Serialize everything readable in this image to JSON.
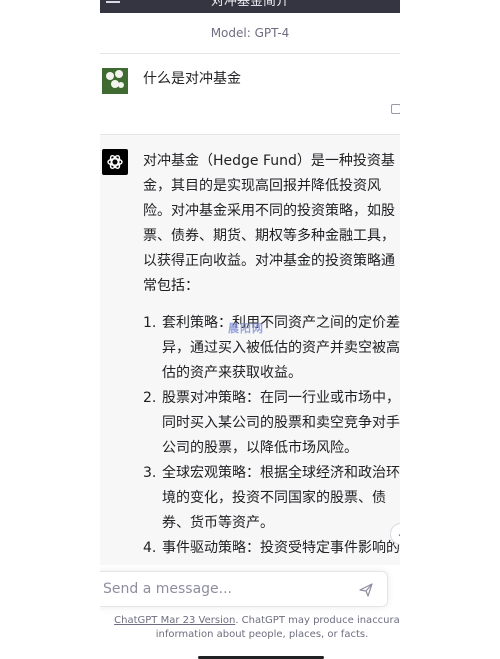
{
  "header": {
    "title": "对冲基金简介",
    "model_label": "Model: GPT-4"
  },
  "user_message": {
    "text": "什么是对冲基金"
  },
  "assistant_message": {
    "intro": "对冲基金（Hedge Fund）是一种投资基金，其目的是实现高回报并降低投资风险。对冲基金采用不同的投资策略，如股票、债券、期货、期权等多种金融工具，以获得正向收益。对冲基金的投资策略通常包括：",
    "items": [
      {
        "num": "1.",
        "text": "套利策略：利用不同资产之间的定价差异，通过买入被低估的资产并卖空被高估的资产来获取收益。"
      },
      {
        "num": "2.",
        "text": "股票对冲策略：在同一行业或市场中，同时买入某公司的股票和卖空竞争对手公司的股票，以降低市场风险。"
      },
      {
        "num": "3.",
        "text": "全球宏观策略：根据全球经济和政治环境的变化，投资不同国家的股票、债券、货币等资产。"
      },
      {
        "num": "4.",
        "text": "事件驱动策略：投资受特定事件影响的"
      }
    ]
  },
  "watermark_text": "晨阳网",
  "composer": {
    "placeholder": "Send a message..."
  },
  "footer": {
    "link_text": "ChatGPT Mar 23 Version",
    "text": ". ChatGPT may produce inaccurate information about people, places, or facts."
  },
  "colors": {
    "topbar": "#343541",
    "assistant_bg": "#f7f7f8",
    "text": "#202123"
  }
}
